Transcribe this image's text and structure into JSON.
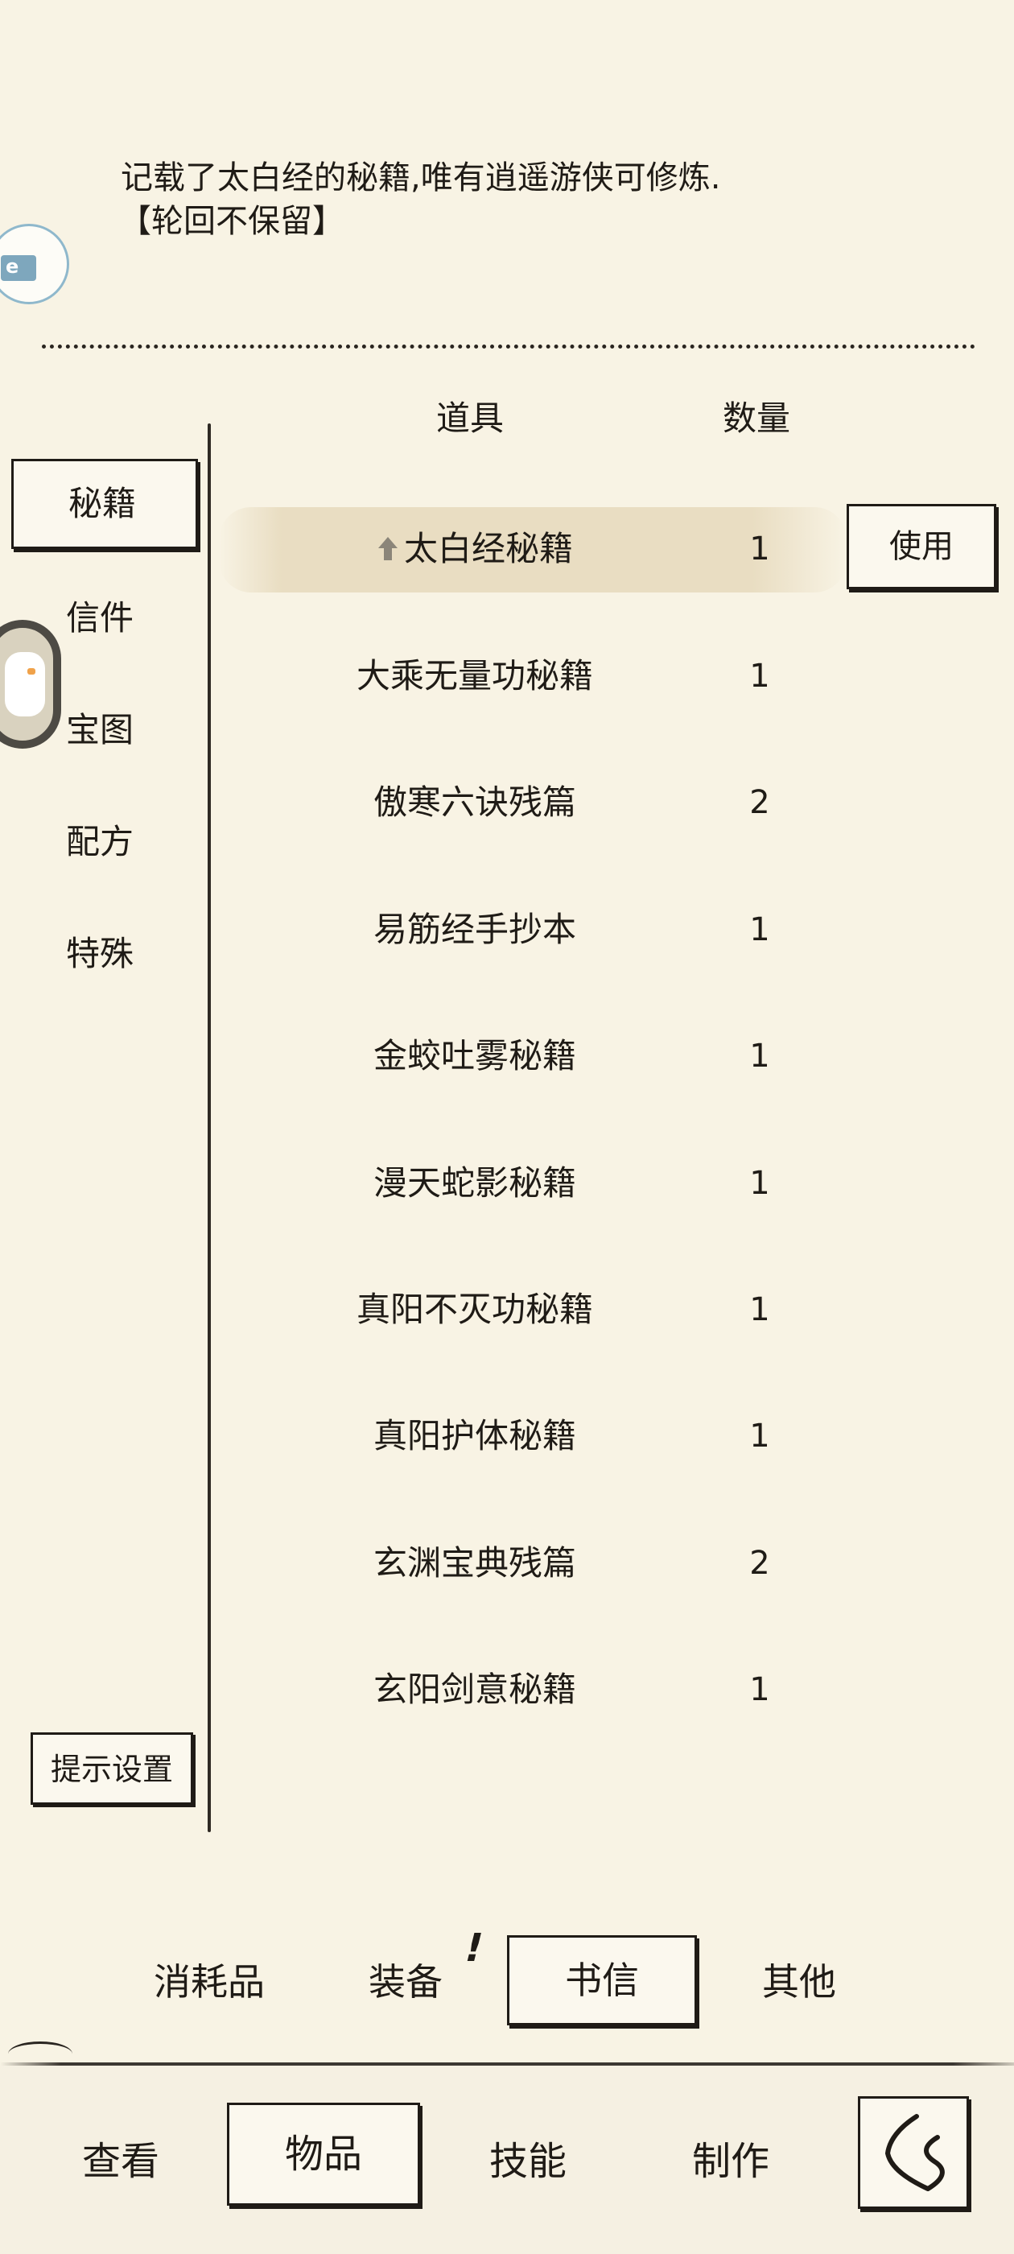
{
  "description": {
    "line1": "记载了太白经的秘籍,唯有逍遥游侠可修炼.",
    "line2": "【轮回不保留】"
  },
  "table": {
    "header_item": "道具",
    "header_qty": "数量",
    "rows": [
      {
        "name": "太白经秘籍",
        "qty": "1"
      },
      {
        "name": "大乘无量功秘籍",
        "qty": "1"
      },
      {
        "name": "傲寒六诀残篇",
        "qty": "2"
      },
      {
        "name": "易筋经手抄本",
        "qty": "1"
      },
      {
        "name": "金蛟吐雾秘籍",
        "qty": "1"
      },
      {
        "name": "漫天蛇影秘籍",
        "qty": "1"
      },
      {
        "name": "真阳不灭功秘籍",
        "qty": "1"
      },
      {
        "name": "真阳护体秘籍",
        "qty": "1"
      },
      {
        "name": "玄渊宝典残篇",
        "qty": "2"
      },
      {
        "name": "玄阳剑意秘籍",
        "qty": "1"
      }
    ],
    "use_label": "使用"
  },
  "sidebar": {
    "tabs": [
      "秘籍",
      "信件",
      "宝图",
      "配方",
      "特殊"
    ],
    "hint_label": "提示设置"
  },
  "categories": {
    "items": [
      "消耗品",
      "装备",
      "书信",
      "其他"
    ],
    "badge": "!"
  },
  "bottom_nav": {
    "items": [
      "查看",
      "物品",
      "技能",
      "制作"
    ]
  },
  "icons": {
    "top_float": "app-badge-icon",
    "mid_float": "duck-mascot-icon",
    "row_marker": "arrow-up-icon",
    "back": "back-arrow-icon"
  },
  "colors": {
    "background": "#f8f3e4",
    "ink": "#1f1b16",
    "highlight": "#e8dcc0"
  }
}
